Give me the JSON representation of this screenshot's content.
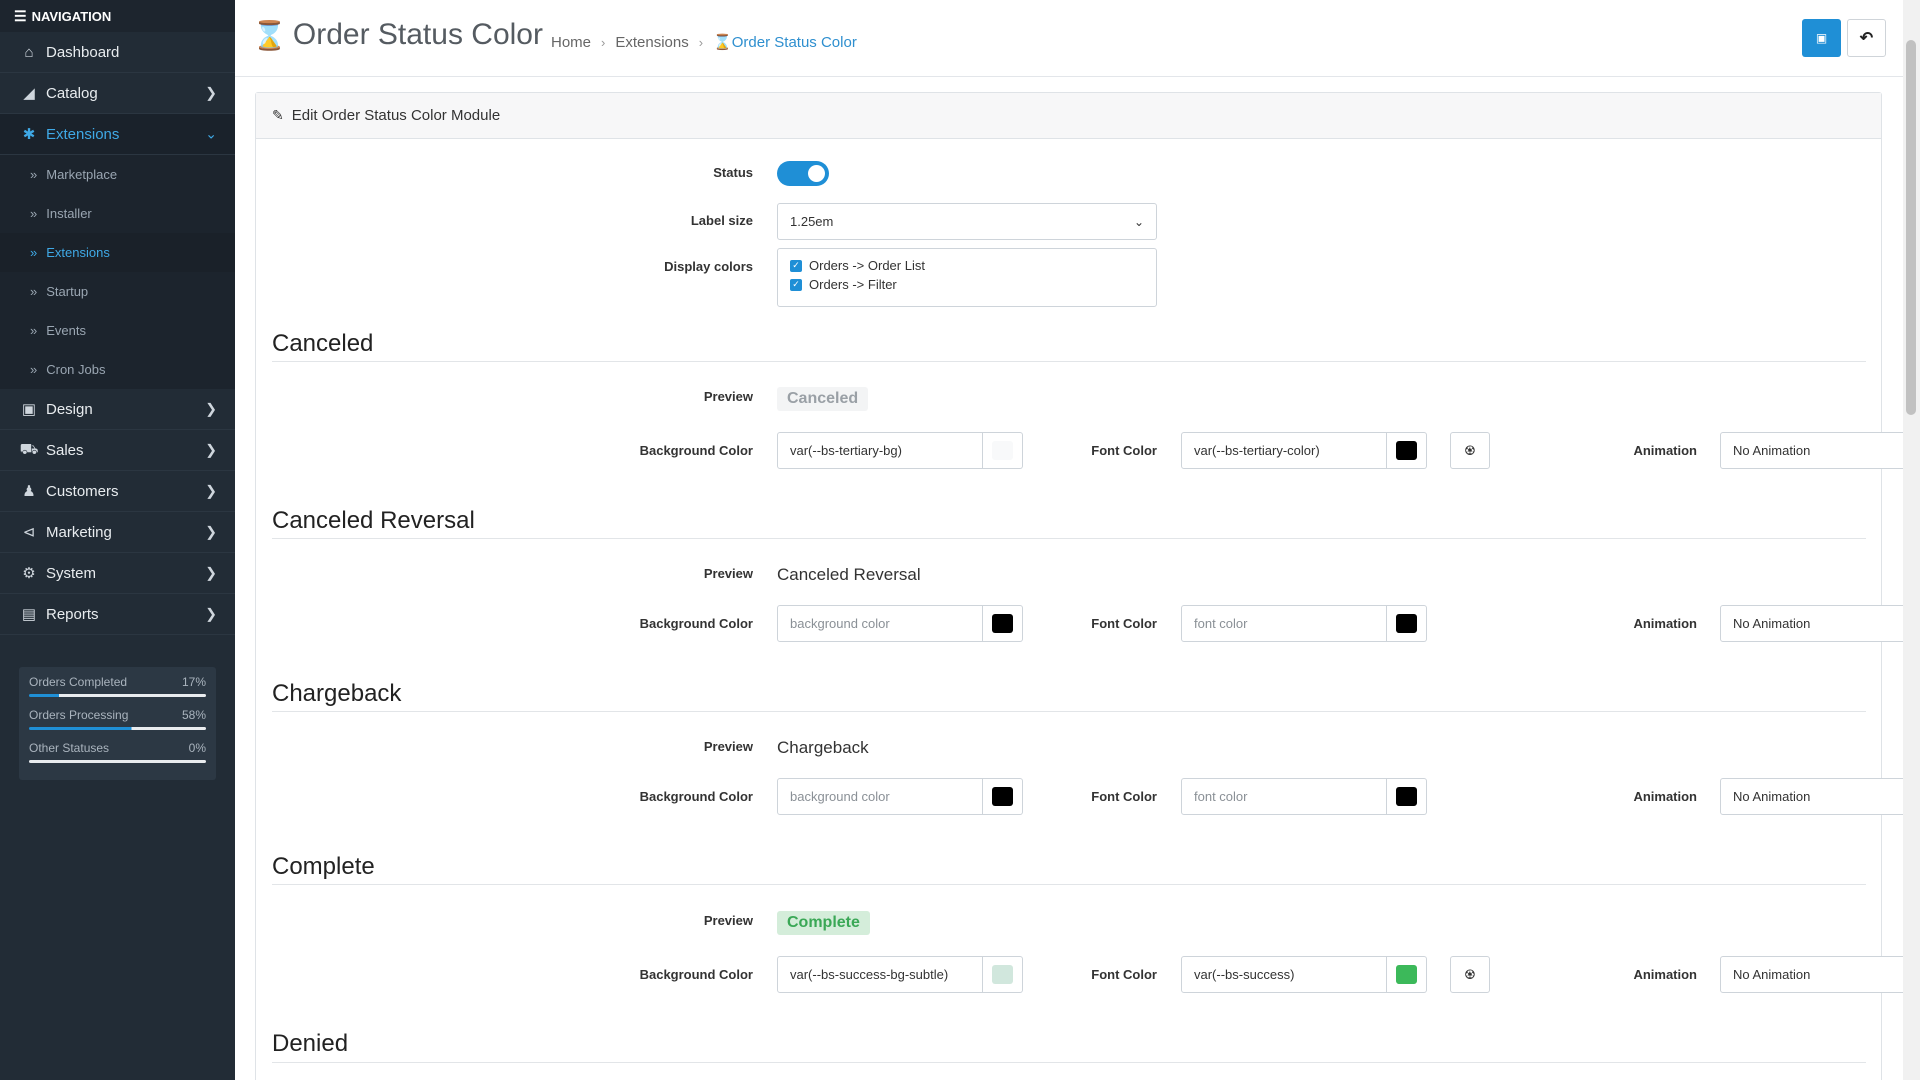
{
  "sidebar": {
    "header": "NAVIGATION",
    "items": [
      {
        "label": "Dashboard",
        "icon": "home-icon"
      },
      {
        "label": "Catalog",
        "icon": "tag-icon"
      },
      {
        "label": "Extensions",
        "icon": "puzzle-icon"
      },
      {
        "label": "Design",
        "icon": "monitor-icon"
      },
      {
        "label": "Sales",
        "icon": "cart-icon"
      },
      {
        "label": "Customers",
        "icon": "user-icon"
      },
      {
        "label": "Marketing",
        "icon": "share-icon"
      },
      {
        "label": "System",
        "icon": "gear-icon"
      },
      {
        "label": "Reports",
        "icon": "bar-chart-icon"
      }
    ],
    "sub_items": [
      "Marketplace",
      "Installer",
      "Extensions",
      "Startup",
      "Events",
      "Cron Jobs"
    ],
    "stats": [
      {
        "label": "Orders Completed",
        "value": "17%",
        "fraction": 0.17
      },
      {
        "label": "Orders Processing",
        "value": "58%",
        "fraction": 0.58
      },
      {
        "label": "Other Statuses",
        "value": "0%",
        "fraction": 0.0
      }
    ]
  },
  "header": {
    "title": "Order Status Color",
    "breadcrumbs": [
      "Home",
      "Extensions",
      "Order Status Color"
    ],
    "save_icon": "save-icon",
    "back_icon": "back-arrow-icon",
    "accent": "#1f8fd6"
  },
  "card": {
    "title": "Edit Order Status Color Module",
    "status_label": "Status",
    "status_on": true,
    "label_size_label": "Label size",
    "label_size_value": "1.25em",
    "display_colors_label": "Display colors",
    "display_colors": [
      "Orders -> Order List",
      "Orders -> Filter"
    ]
  },
  "field_labels": {
    "preview": "Preview",
    "background": "Background Color",
    "font": "Font Color",
    "animation": "Animation"
  },
  "statuses": [
    {
      "name": "Canceled",
      "preview": "Canceled",
      "bg_value": "var(--bs-tertiary-bg)",
      "bg_swatch": "#f8f9fa",
      "font_value": "var(--bs-tertiary-color)",
      "font_swatch": "#000000",
      "animation": "No Animation",
      "preview_bg": "#f3f4f5",
      "preview_fg": "#9aa0a6"
    },
    {
      "name": "Canceled Reversal",
      "preview": "Canceled Reversal",
      "bg_placeholder": "background color",
      "bg_swatch": "#000000",
      "font_placeholder": "font color",
      "font_swatch": "#000000",
      "animation": "No Animation"
    },
    {
      "name": "Chargeback",
      "preview": "Chargeback",
      "bg_placeholder": "background color",
      "bg_swatch": "#000000",
      "font_placeholder": "font color",
      "font_swatch": "#000000",
      "animation": "No Animation"
    },
    {
      "name": "Complete",
      "preview": "Complete",
      "bg_value": "var(--bs-success-bg-subtle)",
      "bg_swatch": "#d1e7dd",
      "font_value": "var(--bs-success)",
      "font_swatch": "#3cb95a",
      "animation": "No Animation",
      "preview_bg": "#d4edda",
      "preview_fg": "#3aa856"
    },
    {
      "name": "Denied"
    }
  ]
}
